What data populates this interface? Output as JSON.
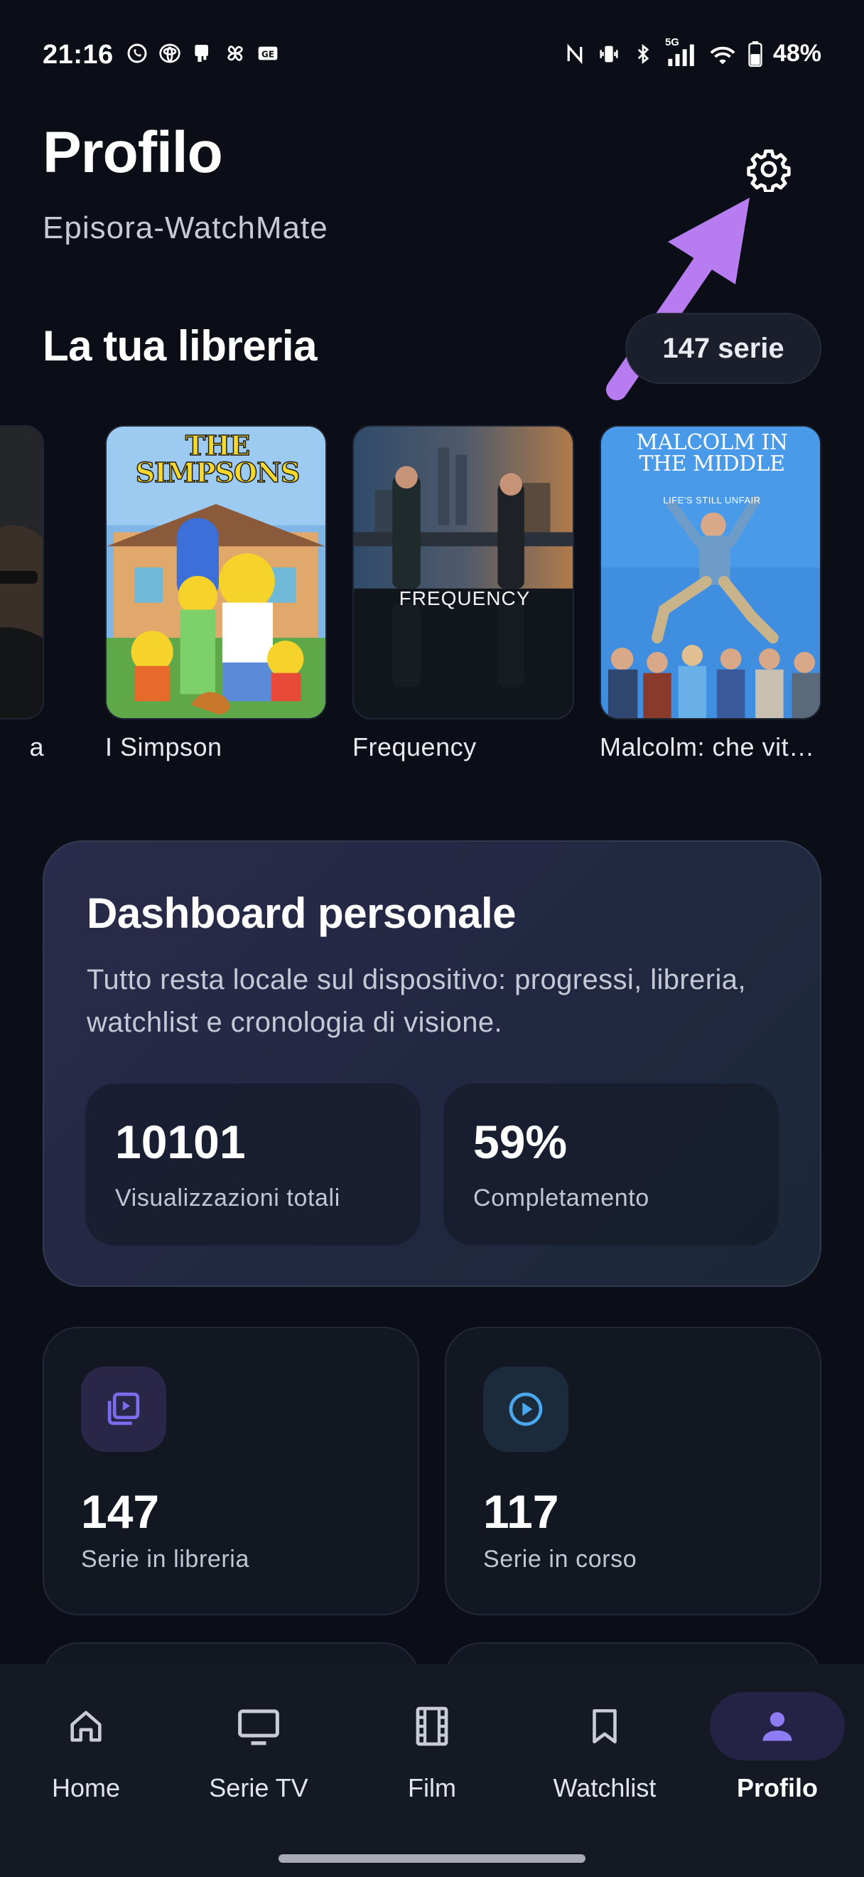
{
  "status_bar": {
    "time": "21:16",
    "battery_text": "48%",
    "network_label": "5G",
    "left_icons": [
      "whatsapp-icon",
      "toyota-icon",
      "app-icon",
      "pinwheel-icon",
      "ge-icon"
    ],
    "right_icons": [
      "nfc-icon",
      "vibrate-icon",
      "bluetooth-icon",
      "signal-icon",
      "wifi-icon",
      "battery-icon"
    ]
  },
  "header": {
    "title": "Profilo",
    "subtitle": "Episora-WatchMate",
    "settings_icon": "gear-icon"
  },
  "library": {
    "title": "La tua libreria",
    "count_badge": "147 serie",
    "items": [
      {
        "label": "a"
      },
      {
        "label": "I Simpson",
        "poster_logo": "THE SIMPSONS"
      },
      {
        "label": "Frequency",
        "poster_logo": "FREQUENCY"
      },
      {
        "label": "Malcolm: che vit…",
        "poster_logo": "MALCOLM IN THE MIDDLE",
        "poster_tagline": "LIFE'S STILL UNFAIR"
      }
    ]
  },
  "dashboard": {
    "title": "Dashboard personale",
    "description": "Tutto resta locale sul dispositivo: progressi, libreria, watchlist e cronologia di visione.",
    "stats": [
      {
        "value": "10101",
        "label": "Visualizzazioni totali"
      },
      {
        "value": "59%",
        "label": "Completamento"
      }
    ]
  },
  "metrics": [
    {
      "value": "147",
      "label": "Serie in libreria",
      "icon": "library-icon",
      "color": "#7c6cf0"
    },
    {
      "value": "117",
      "label": "Serie in corso",
      "icon": "play-circle-icon",
      "color": "#4aa8ee"
    }
  ],
  "bottom_nav": {
    "items": [
      {
        "label": "Home",
        "icon": "home-icon"
      },
      {
        "label": "Serie TV",
        "icon": "tv-icon"
      },
      {
        "label": "Film",
        "icon": "film-icon"
      },
      {
        "label": "Watchlist",
        "icon": "bookmark-icon"
      },
      {
        "label": "Profilo",
        "icon": "person-icon",
        "active": true
      }
    ]
  },
  "colors": {
    "background": "#0b0e16",
    "accent": "#7c6cf0",
    "annotation_arrow": "#b77cf0"
  }
}
